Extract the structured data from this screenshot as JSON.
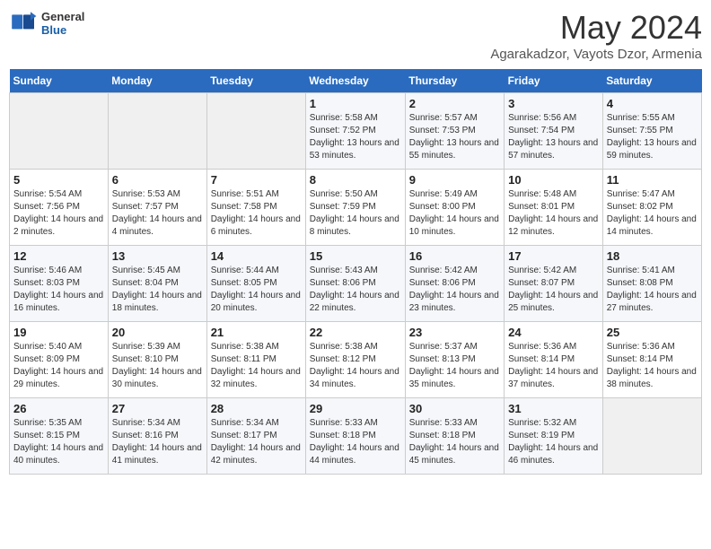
{
  "logo": {
    "general": "General",
    "blue": "Blue"
  },
  "header": {
    "month_year": "May 2024",
    "location": "Agarakadzor, Vayots Dzor, Armenia"
  },
  "days_of_week": [
    "Sunday",
    "Monday",
    "Tuesday",
    "Wednesday",
    "Thursday",
    "Friday",
    "Saturday"
  ],
  "weeks": [
    [
      {
        "day": "",
        "info": ""
      },
      {
        "day": "",
        "info": ""
      },
      {
        "day": "",
        "info": ""
      },
      {
        "day": "1",
        "info": "Sunrise: 5:58 AM\nSunset: 7:52 PM\nDaylight: 13 hours and 53 minutes."
      },
      {
        "day": "2",
        "info": "Sunrise: 5:57 AM\nSunset: 7:53 PM\nDaylight: 13 hours and 55 minutes."
      },
      {
        "day": "3",
        "info": "Sunrise: 5:56 AM\nSunset: 7:54 PM\nDaylight: 13 hours and 57 minutes."
      },
      {
        "day": "4",
        "info": "Sunrise: 5:55 AM\nSunset: 7:55 PM\nDaylight: 13 hours and 59 minutes."
      }
    ],
    [
      {
        "day": "5",
        "info": "Sunrise: 5:54 AM\nSunset: 7:56 PM\nDaylight: 14 hours and 2 minutes."
      },
      {
        "day": "6",
        "info": "Sunrise: 5:53 AM\nSunset: 7:57 PM\nDaylight: 14 hours and 4 minutes."
      },
      {
        "day": "7",
        "info": "Sunrise: 5:51 AM\nSunset: 7:58 PM\nDaylight: 14 hours and 6 minutes."
      },
      {
        "day": "8",
        "info": "Sunrise: 5:50 AM\nSunset: 7:59 PM\nDaylight: 14 hours and 8 minutes."
      },
      {
        "day": "9",
        "info": "Sunrise: 5:49 AM\nSunset: 8:00 PM\nDaylight: 14 hours and 10 minutes."
      },
      {
        "day": "10",
        "info": "Sunrise: 5:48 AM\nSunset: 8:01 PM\nDaylight: 14 hours and 12 minutes."
      },
      {
        "day": "11",
        "info": "Sunrise: 5:47 AM\nSunset: 8:02 PM\nDaylight: 14 hours and 14 minutes."
      }
    ],
    [
      {
        "day": "12",
        "info": "Sunrise: 5:46 AM\nSunset: 8:03 PM\nDaylight: 14 hours and 16 minutes."
      },
      {
        "day": "13",
        "info": "Sunrise: 5:45 AM\nSunset: 8:04 PM\nDaylight: 14 hours and 18 minutes."
      },
      {
        "day": "14",
        "info": "Sunrise: 5:44 AM\nSunset: 8:05 PM\nDaylight: 14 hours and 20 minutes."
      },
      {
        "day": "15",
        "info": "Sunrise: 5:43 AM\nSunset: 8:06 PM\nDaylight: 14 hours and 22 minutes."
      },
      {
        "day": "16",
        "info": "Sunrise: 5:42 AM\nSunset: 8:06 PM\nDaylight: 14 hours and 23 minutes."
      },
      {
        "day": "17",
        "info": "Sunrise: 5:42 AM\nSunset: 8:07 PM\nDaylight: 14 hours and 25 minutes."
      },
      {
        "day": "18",
        "info": "Sunrise: 5:41 AM\nSunset: 8:08 PM\nDaylight: 14 hours and 27 minutes."
      }
    ],
    [
      {
        "day": "19",
        "info": "Sunrise: 5:40 AM\nSunset: 8:09 PM\nDaylight: 14 hours and 29 minutes."
      },
      {
        "day": "20",
        "info": "Sunrise: 5:39 AM\nSunset: 8:10 PM\nDaylight: 14 hours and 30 minutes."
      },
      {
        "day": "21",
        "info": "Sunrise: 5:38 AM\nSunset: 8:11 PM\nDaylight: 14 hours and 32 minutes."
      },
      {
        "day": "22",
        "info": "Sunrise: 5:38 AM\nSunset: 8:12 PM\nDaylight: 14 hours and 34 minutes."
      },
      {
        "day": "23",
        "info": "Sunrise: 5:37 AM\nSunset: 8:13 PM\nDaylight: 14 hours and 35 minutes."
      },
      {
        "day": "24",
        "info": "Sunrise: 5:36 AM\nSunset: 8:14 PM\nDaylight: 14 hours and 37 minutes."
      },
      {
        "day": "25",
        "info": "Sunrise: 5:36 AM\nSunset: 8:14 PM\nDaylight: 14 hours and 38 minutes."
      }
    ],
    [
      {
        "day": "26",
        "info": "Sunrise: 5:35 AM\nSunset: 8:15 PM\nDaylight: 14 hours and 40 minutes."
      },
      {
        "day": "27",
        "info": "Sunrise: 5:34 AM\nSunset: 8:16 PM\nDaylight: 14 hours and 41 minutes."
      },
      {
        "day": "28",
        "info": "Sunrise: 5:34 AM\nSunset: 8:17 PM\nDaylight: 14 hours and 42 minutes."
      },
      {
        "day": "29",
        "info": "Sunrise: 5:33 AM\nSunset: 8:18 PM\nDaylight: 14 hours and 44 minutes."
      },
      {
        "day": "30",
        "info": "Sunrise: 5:33 AM\nSunset: 8:18 PM\nDaylight: 14 hours and 45 minutes."
      },
      {
        "day": "31",
        "info": "Sunrise: 5:32 AM\nSunset: 8:19 PM\nDaylight: 14 hours and 46 minutes."
      },
      {
        "day": "",
        "info": ""
      }
    ]
  ]
}
